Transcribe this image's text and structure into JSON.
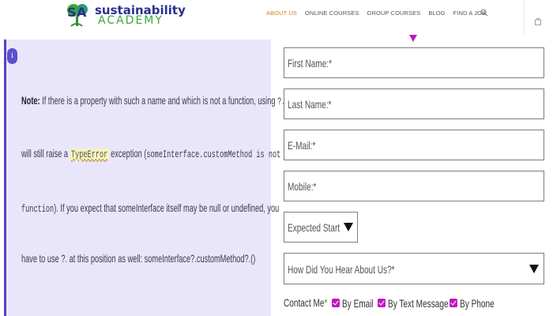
{
  "header": {
    "logo": {
      "line1": "sustainability",
      "line2": "ACADEMY",
      "mark": "SA"
    },
    "nav": [
      {
        "label": "ABOUT US",
        "active": true
      },
      {
        "label": "ONLINE COURSES",
        "active": false
      },
      {
        "label": "GROUP COURSES",
        "active": false
      },
      {
        "label": "BLOG",
        "active": false
      },
      {
        "label": "FIND A JOB",
        "active": false
      }
    ],
    "icons": [
      "search-icon",
      "shopping-bag-icon"
    ]
  },
  "note": {
    "icon": "info-icon",
    "label": "Note:",
    "line1": "If there is a property with such a name and which is not a function, using",
    "line1_code": "?.",
    "line2_a": "will still raise a",
    "line2_code": "TypeError",
    "line2_b": "exception (",
    "line2_code2": "someInterface.customMethod is not a",
    "line3_code": "function",
    "line3_b": "). If you expect that someInterface itself may be null or undefined, you",
    "line4": "have to use ?. at this position as well: someInterface?.customMethod?.()"
  },
  "form": {
    "first_name": "First Name:*",
    "last_name": "Last Name:*",
    "email": "E-Mail:*",
    "mobile": "Mobile:*",
    "expected_start": "Expected Start Y",
    "how_hear": "How Did You Hear About Us?*",
    "contact_me": "Contact Me",
    "contact_req": "*",
    "options": [
      {
        "label": "By Email",
        "checked": true
      },
      {
        "label": "By Text Message",
        "checked": true
      },
      {
        "label": "By Phone",
        "checked": true
      }
    ],
    "accent": "#c318c3"
  },
  "colors": {
    "nav_active": "#e07a1f",
    "note_bg": "#e9e6fb",
    "note_border": "#5b3fc4",
    "brand_blue": "#2b2f8f",
    "brand_green": "#3aa935"
  }
}
